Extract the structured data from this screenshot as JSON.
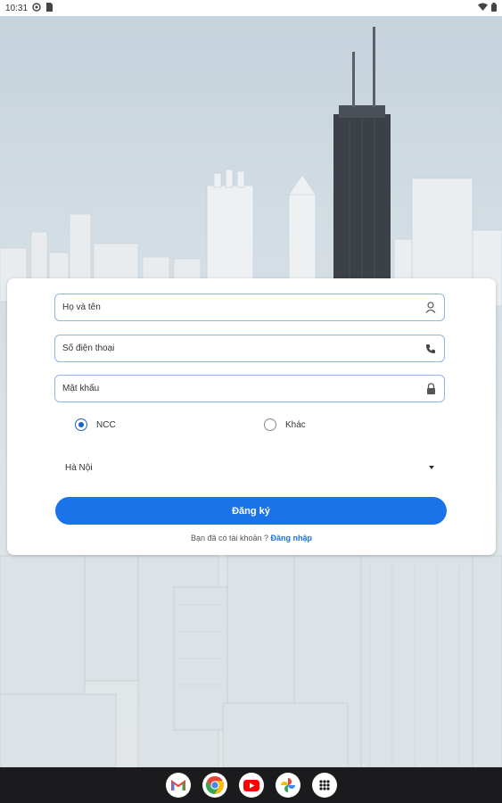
{
  "status_bar": {
    "time": "10:31"
  },
  "form": {
    "name_placeholder": "Họ và tên",
    "phone_placeholder": "Số điện thoại",
    "password_placeholder": "Mật khẩu",
    "role_options": [
      {
        "label": "NCC",
        "selected": true
      },
      {
        "label": "Khác",
        "selected": false
      }
    ],
    "city_selected": "Hà Nội",
    "submit_label": "Đăng ký",
    "have_account_text": "Bạn đã có tài khoản ?",
    "login_link": "Đăng nhập"
  },
  "colors": {
    "accent": "#1a73e8",
    "field_border": "#8fb4e8",
    "navbar": "#1b1b1d"
  },
  "dock": {
    "apps": [
      {
        "name": "Gmail",
        "icon": "gmail-icon"
      },
      {
        "name": "Chrome",
        "icon": "chrome-icon"
      },
      {
        "name": "YouTube",
        "icon": "youtube-icon"
      },
      {
        "name": "Photos",
        "icon": "photos-icon"
      },
      {
        "name": "App drawer",
        "icon": "app-drawer-icon"
      }
    ]
  }
}
